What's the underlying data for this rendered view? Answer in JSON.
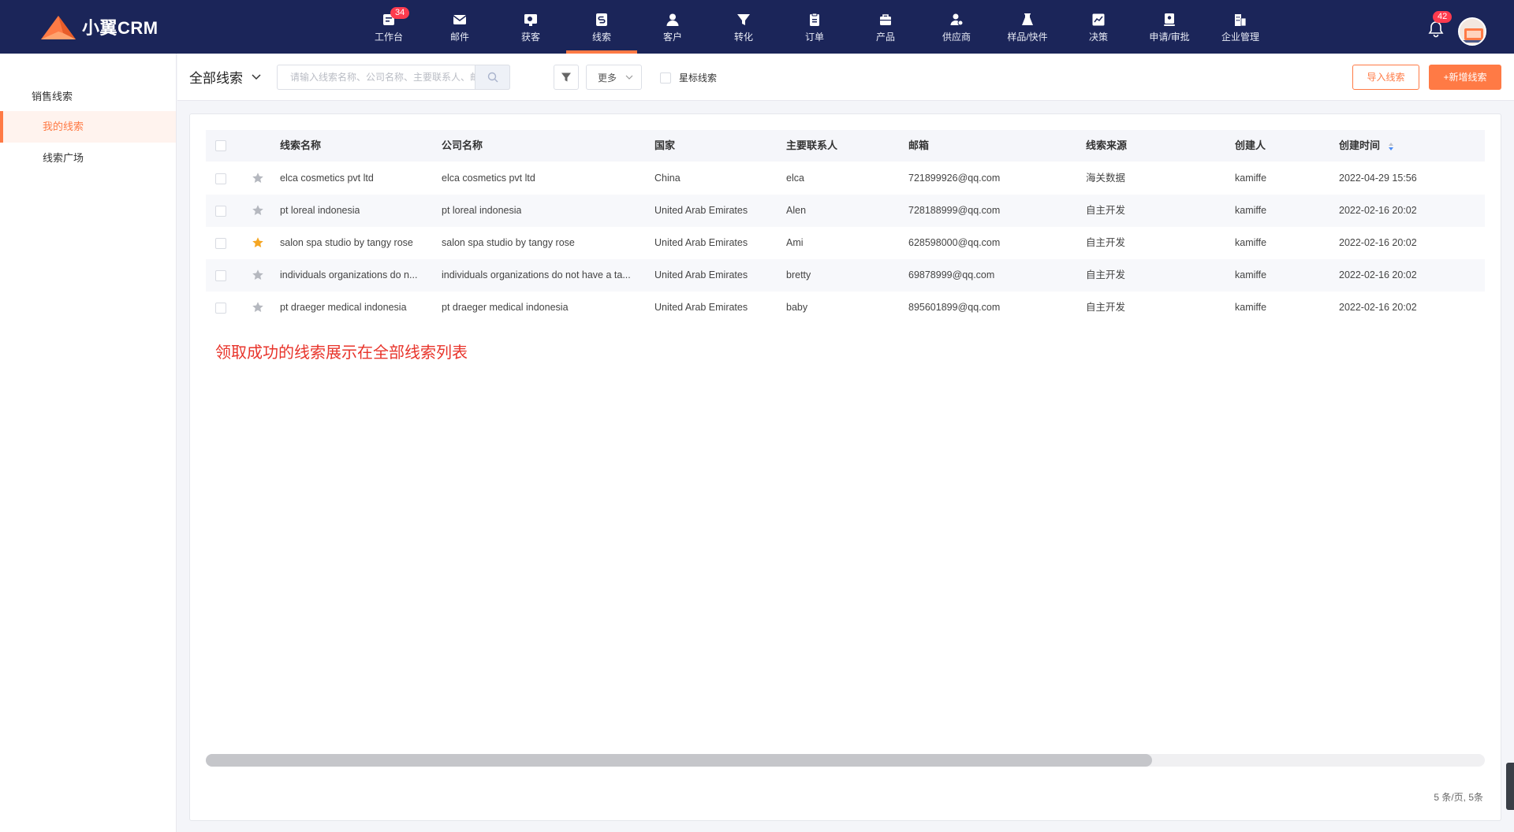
{
  "app": {
    "brand": "小翼CRM",
    "brand_color": "#ff7a45",
    "nav_bg": "#1b2559"
  },
  "nav": {
    "items": [
      {
        "label": "工作台",
        "icon": "workbench-icon",
        "badge": "34"
      },
      {
        "label": "邮件",
        "icon": "mail-icon"
      },
      {
        "label": "获客",
        "icon": "acquire-icon"
      },
      {
        "label": "线索",
        "icon": "leads-icon",
        "active": true
      },
      {
        "label": "客户",
        "icon": "customer-icon"
      },
      {
        "label": "转化",
        "icon": "funnel-icon"
      },
      {
        "label": "订单",
        "icon": "order-icon"
      },
      {
        "label": "产品",
        "icon": "product-icon"
      },
      {
        "label": "供应商",
        "icon": "supplier-icon"
      },
      {
        "label": "样品/快件",
        "icon": "sample-icon"
      },
      {
        "label": "决策",
        "icon": "chart-icon"
      },
      {
        "label": "申请/审批",
        "icon": "approval-icon"
      },
      {
        "label": "企业管理",
        "icon": "company-icon"
      }
    ],
    "notifications_badge": "42"
  },
  "sidebar": {
    "title": "销售线索",
    "items": [
      {
        "label": "我的线索",
        "active": true
      },
      {
        "label": "线索广场"
      }
    ]
  },
  "toolbar": {
    "scope": "全部线索",
    "search_placeholder": "请输入线索名称、公司名称、主要联系人、邮箱",
    "more": "更多",
    "star_filter": "星标线索",
    "import": "导入线索",
    "add": "+新增线索"
  },
  "table": {
    "columns": [
      "线索名称",
      "公司名称",
      "国家",
      "主要联系人",
      "邮箱",
      "线索来源",
      "创建人",
      "创建时间"
    ],
    "rows": [
      {
        "starred": false,
        "name": "elca cosmetics pvt ltd",
        "company": "elca cosmetics pvt ltd",
        "country": "China",
        "contact": "elca",
        "email": "721899926@qq.com",
        "source": "海关数据",
        "creator": "kamiffe",
        "created": "2022-04-29 15:56"
      },
      {
        "starred": false,
        "name": "pt loreal indonesia",
        "company": "pt loreal indonesia",
        "country": "United Arab Emirates",
        "contact": "Alen",
        "email": "728188999@qq.com",
        "source": "自主开发",
        "creator": "kamiffe",
        "created": "2022-02-16 20:02"
      },
      {
        "starred": true,
        "name": "salon spa studio by tangy rose",
        "company": "salon spa studio by tangy rose",
        "country": "United Arab Emirates",
        "contact": "Ami",
        "email": "628598000@qq.com",
        "source": "自主开发",
        "creator": "kamiffe",
        "created": "2022-02-16 20:02"
      },
      {
        "starred": false,
        "name": "individuals organizations do n...",
        "company": "individuals organizations do not have a ta...",
        "country": "United Arab Emirates",
        "contact": "bretty",
        "email": "69878999@qq.com",
        "source": "自主开发",
        "creator": "kamiffe",
        "created": "2022-02-16 20:02"
      },
      {
        "starred": false,
        "name": "pt draeger medical indonesia",
        "company": "pt draeger medical indonesia",
        "country": "United Arab Emirates",
        "contact": "baby",
        "email": "895601899@qq.com",
        "source": "自主开发",
        "creator": "kamiffe",
        "created": "2022-02-16 20:02"
      }
    ]
  },
  "annotation": "领取成功的线索展示在全部线索列表",
  "pagination": {
    "summary": "5 条/页,  5条"
  },
  "scroll": {
    "horizontal_visible_fraction": 0.74
  }
}
